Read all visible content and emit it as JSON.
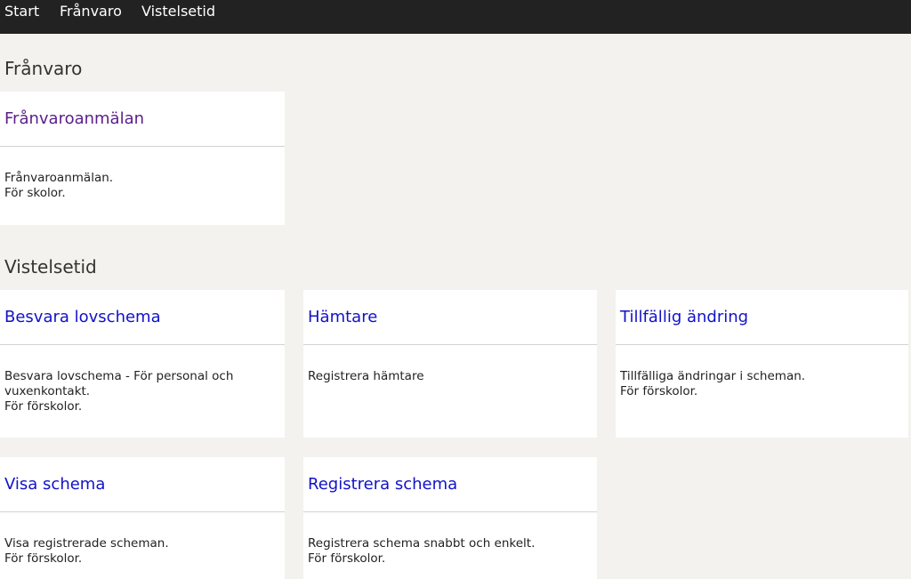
{
  "nav": {
    "items": [
      {
        "label": "Start"
      },
      {
        "label": "Frånvaro"
      },
      {
        "label": "Vistelsetid"
      }
    ]
  },
  "sections": [
    {
      "heading": "Frånvaro",
      "cards": [
        {
          "title": "Frånvaroanmälan",
          "lines": [
            "Frånvaroanmälan.",
            "För skolor."
          ],
          "visited": true
        }
      ]
    },
    {
      "heading": "Vistelsetid",
      "cards": [
        {
          "title": "Besvara lovschema",
          "lines": [
            "Besvara lovschema - För personal och vuxenkontakt.",
            "För förskolor."
          ]
        },
        {
          "title": "Hämtare",
          "lines": [
            "Registrera hämtare"
          ]
        },
        {
          "title": "Tillfällig ändring",
          "lines": [
            "Tillfälliga ändringar i scheman.",
            "För förskolor."
          ]
        },
        {
          "title": "Visa schema",
          "lines": [
            "Visa registrerade scheman.",
            "För förskolor."
          ]
        },
        {
          "title": "Registrera schema",
          "lines": [
            "Registrera schema snabbt och enkelt.",
            "För förskolor."
          ]
        }
      ]
    }
  ],
  "colors": {
    "nav_background": "#222222",
    "page_background": "#f3f2ee",
    "link": "#1212c8",
    "visited_link": "#5a1e8c"
  }
}
